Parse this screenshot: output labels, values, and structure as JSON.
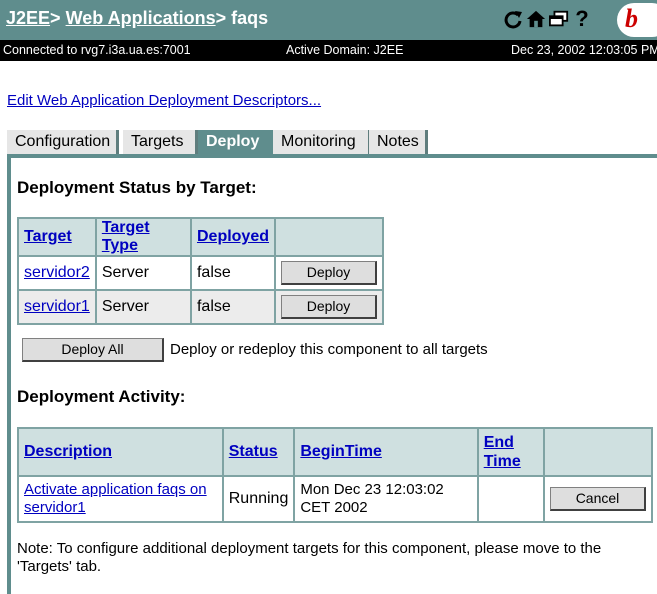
{
  "header": {
    "crumb_root": "J2EE",
    "separator1": ">",
    "crumb_app": "Web Applications",
    "separator2": ">",
    "crumb_current": "faqs",
    "icons": [
      "refresh-icon",
      "home-icon",
      "windows-icon",
      "help-icon"
    ],
    "logo_text": "b"
  },
  "status": {
    "connected": "Connected to rvg7.i3a.ua.es:7001",
    "domain": "Active Domain: J2EE",
    "datetime": "Dec 23, 2002 12:03:05 PM"
  },
  "edit_link": "Edit Web Application Deployment Descriptors...",
  "tabs": [
    {
      "label": "Configuration"
    },
    {
      "label": "Targets"
    },
    {
      "label": "Deploy"
    },
    {
      "label": "Monitoring"
    },
    {
      "label": "Notes"
    }
  ],
  "active_tab": "Deploy",
  "deployment_status": {
    "heading": "Deployment Status by Target:",
    "headers": [
      "Target",
      "Target Type",
      "Deployed",
      ""
    ],
    "rows": [
      {
        "target": "servidor2",
        "type": "Server",
        "deployed": "false",
        "button": "Deploy"
      },
      {
        "target": "servidor1",
        "type": "Server",
        "deployed": "false",
        "button": "Deploy"
      }
    ]
  },
  "deploy_all": {
    "button": "Deploy All",
    "description": "Deploy or redeploy this component to all targets"
  },
  "deployment_activity": {
    "heading": "Deployment Activity:",
    "headers": [
      "Description",
      "Status",
      "BeginTime",
      "End Time",
      ""
    ],
    "rows": [
      {
        "description": "Activate application faqs on servidor1",
        "status": "Running",
        "begin": "Mon Dec 23 12:03:02 CET 2002",
        "end": "",
        "button": "Cancel"
      }
    ]
  },
  "note": "Note: To configure additional deployment targets for this component, please move to the 'Targets' tab.",
  "colors": {
    "header_bg": "#5f8d8d",
    "table_header": "#cfe0e0",
    "link": "#0000c0"
  }
}
